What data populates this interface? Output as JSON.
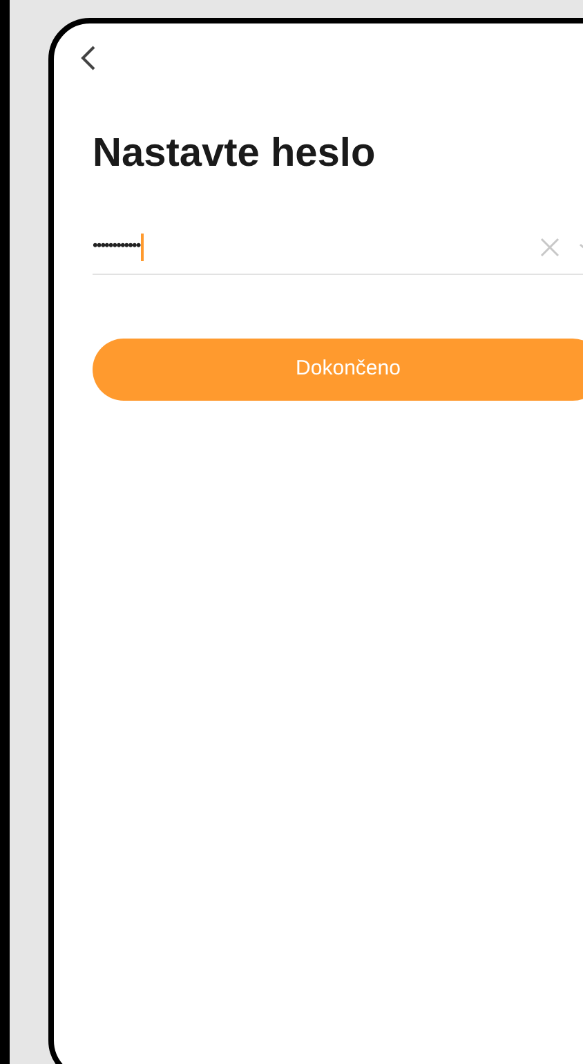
{
  "title": "Nastavte heslo",
  "password_field": {
    "value": "••••••••••••",
    "focused": true
  },
  "button": {
    "label": "Dokončeno"
  }
}
